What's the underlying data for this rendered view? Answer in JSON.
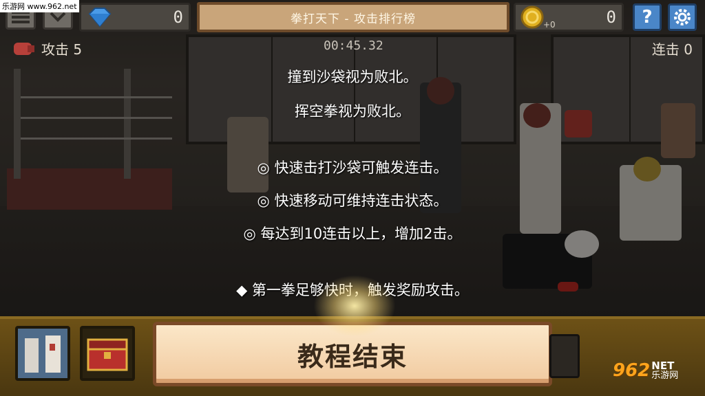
{
  "topbar": {
    "title": "拳打天下 - 攻击排行榜",
    "gems": "0",
    "coins": "0",
    "coin_bonus": "+0",
    "help_glyph": "?",
    "icons": [
      "menu-icon",
      "chevron-down-icon",
      "gem-icon",
      "coin-icon",
      "help-icon",
      "settings-icon"
    ]
  },
  "hud": {
    "attack_label": "攻击 5",
    "combo_label": "连击 0",
    "timer": "00:45.32"
  },
  "tutorial": {
    "lines": [
      "撞到沙袋视为败北。",
      "挥空拳视为败北。",
      "◎ 快速击打沙袋可触发连击。",
      "◎ 快速移动可维持连击状态。",
      "◎ 每达到10连击以上，增加2击。",
      "◆ 第一拳足够快时，触发奖励攻击。"
    ]
  },
  "bottom": {
    "end_tutorial_label": "教程结束"
  },
  "watermark": {
    "top": "乐游网 www.962.net",
    "logo_big": "962",
    "logo_net": "NET",
    "logo_cn": "乐游网"
  },
  "colors": {
    "gem": "#4a9be8",
    "coin": "#e0b020",
    "button_face": "#f7dcb6",
    "title_bar": "#c9a57a",
    "blue_button": "#4a86c8"
  }
}
